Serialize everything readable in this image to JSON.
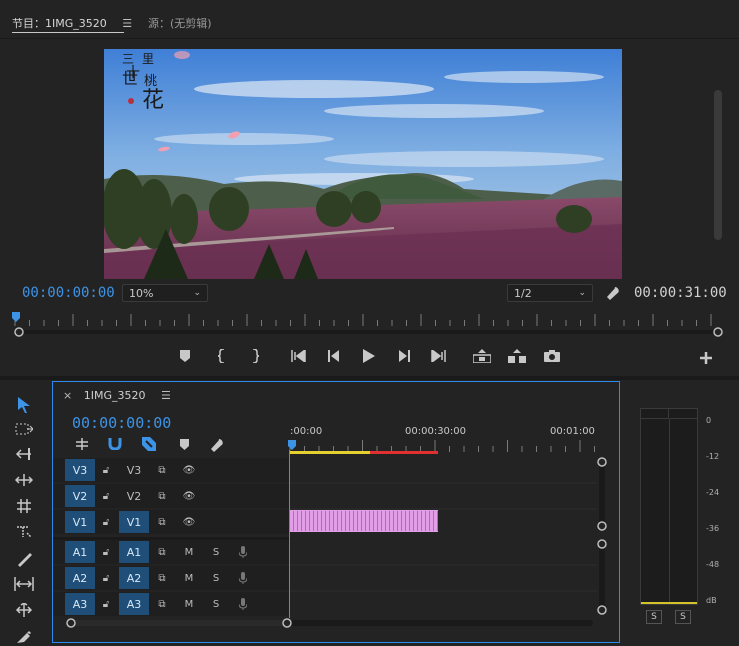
{
  "program_monitor": {
    "tab_label": "节目：1IMG_3520",
    "source_tab_label": "源：(无剪辑)",
    "menu_icon": "hamburger-icon",
    "image_title_chars": [
      "三",
      "世",
      "十",
      "里",
      "桃",
      "花"
    ],
    "current_timecode": "00:00:00:00",
    "zoom": "10%",
    "resolution": "1/2",
    "duration_timecode": "00:00:31:00",
    "controls": [
      "add-marker-icon",
      "mark-in-icon",
      "mark-out-icon",
      "go-to-in-icon",
      "step-back-icon",
      "play-icon",
      "step-forward-icon",
      "go-to-out-icon",
      "lift-icon",
      "extract-icon",
      "export-frame-icon",
      "add-button-icon"
    ],
    "playback_position": 0.0
  },
  "timeline": {
    "tab_label": "1IMG_3520",
    "current_timecode": "00:00:00:00",
    "ruler_labels": [
      ":00:00",
      "00:00:30:00",
      "00:01:00"
    ],
    "video_tracks": [
      {
        "id": "V3",
        "source": "V3",
        "source_active": false
      },
      {
        "id": "V2",
        "source": "V2",
        "source_active": false
      },
      {
        "id": "V1",
        "source": "V1",
        "source_active": true
      }
    ],
    "audio_tracks": [
      {
        "id": "A1",
        "source": "A1",
        "mute": "M",
        "solo": "S"
      },
      {
        "id": "A2",
        "source": "A2",
        "mute": "M",
        "solo": "S"
      },
      {
        "id": "A3",
        "source": "A3",
        "mute": "M",
        "solo": "S"
      }
    ],
    "clip_color": "#e29ee6",
    "render_bar_colors": [
      "#e6d030",
      "#e03030"
    ]
  },
  "tools": [
    "selection-tool-icon",
    "track-select-tool-icon",
    "ripple-edit-tool-icon",
    "rolling-edit-tool-icon",
    "rate-stretch-tool-icon",
    "razor-tool-icon",
    "slip-tool-icon",
    "slide-tool-icon",
    "pen-tool-icon"
  ],
  "audio_meter": {
    "scale": [
      "0",
      "-12",
      "-24",
      "-36",
      "-48",
      "dB"
    ],
    "solo_buttons": [
      "S",
      "S"
    ]
  },
  "accent_color": "#3d93e6"
}
